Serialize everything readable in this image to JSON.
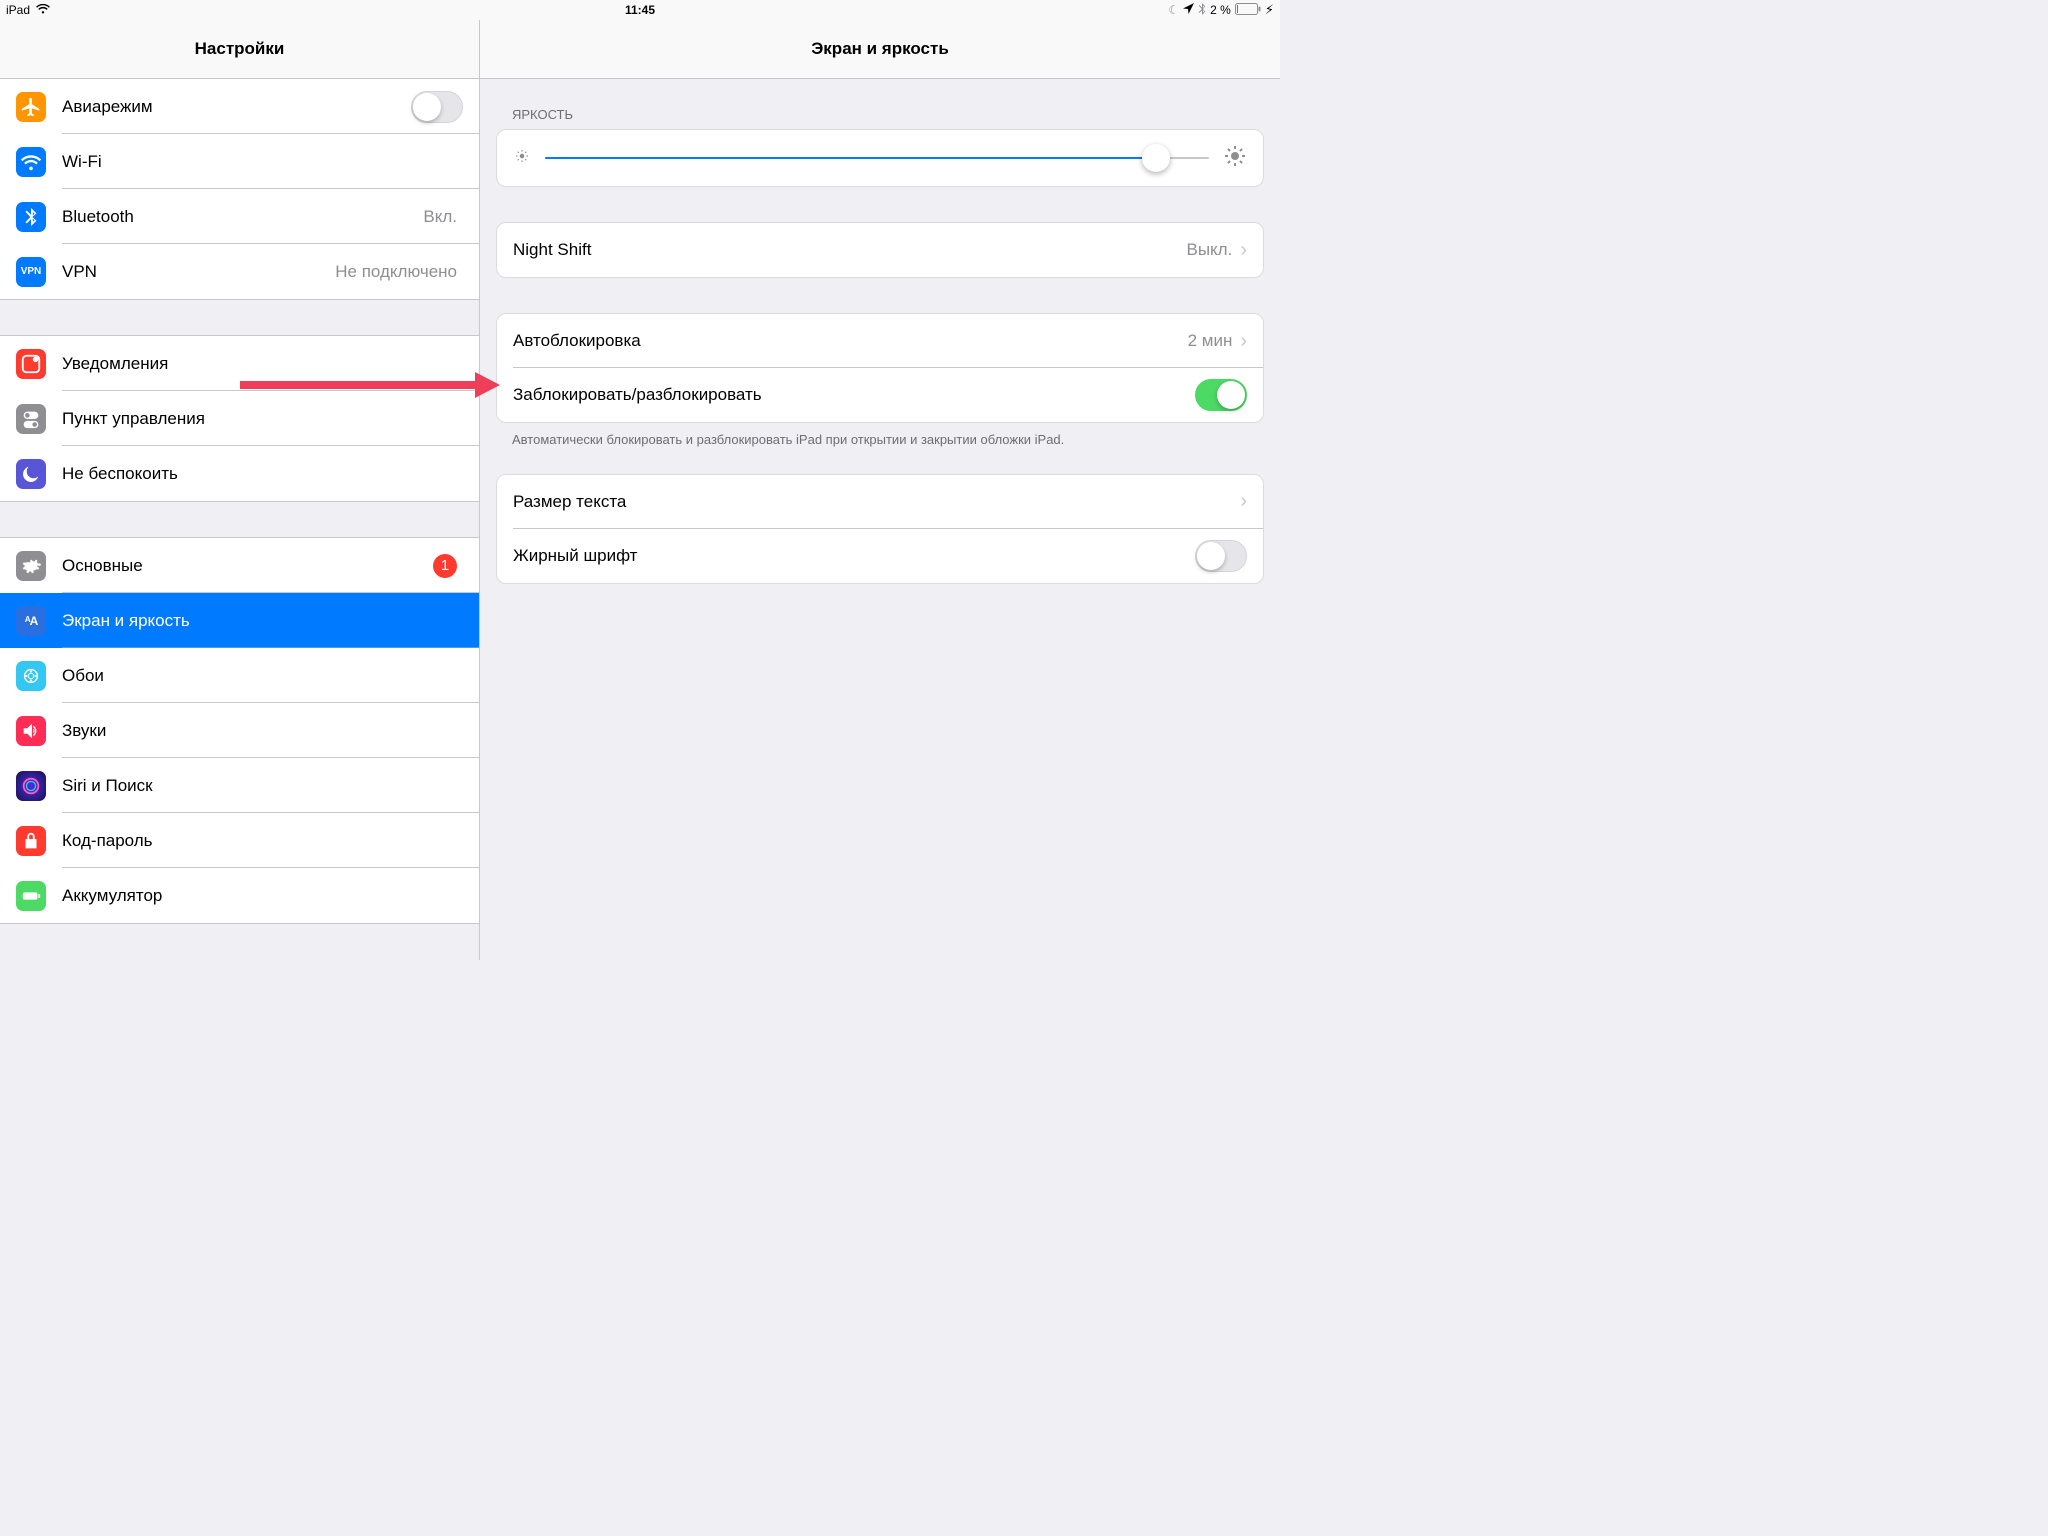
{
  "statusbar": {
    "device": "iPad",
    "time": "11:45",
    "battery": "2 %"
  },
  "sidebar": {
    "title": "Настройки",
    "g1": {
      "airplane": "Авиарежим",
      "wifi": "Wi-Fi",
      "bluetooth": "Bluetooth",
      "bluetooth_value": "Вкл.",
      "vpn": "VPN",
      "vpn_value": "Не подключено"
    },
    "g2": {
      "notifications": "Уведомления",
      "control_center": "Пункт управления",
      "dnd": "Не беспокоить"
    },
    "g3": {
      "general": "Основные",
      "general_badge": "1",
      "display": "Экран и яркость",
      "wallpaper": "Обои",
      "sounds": "Звуки",
      "siri": "Siri и Поиск",
      "passcode": "Код-пароль",
      "battery": "Аккумулятор"
    }
  },
  "detail": {
    "title": "Экран и яркость",
    "brightness_header": "ЯРКОСТЬ",
    "night_shift": "Night Shift",
    "night_shift_value": "Выкл.",
    "autolock": "Автоблокировка",
    "autolock_value": "2 мин",
    "lock_unlock": "Заблокировать/разблокировать",
    "lock_footer": "Автоматически блокировать и разблокировать iPad при открытии и закрытии обложки iPad.",
    "text_size": "Размер текста",
    "bold": "Жирный шрифт"
  },
  "slider_percent": 92
}
